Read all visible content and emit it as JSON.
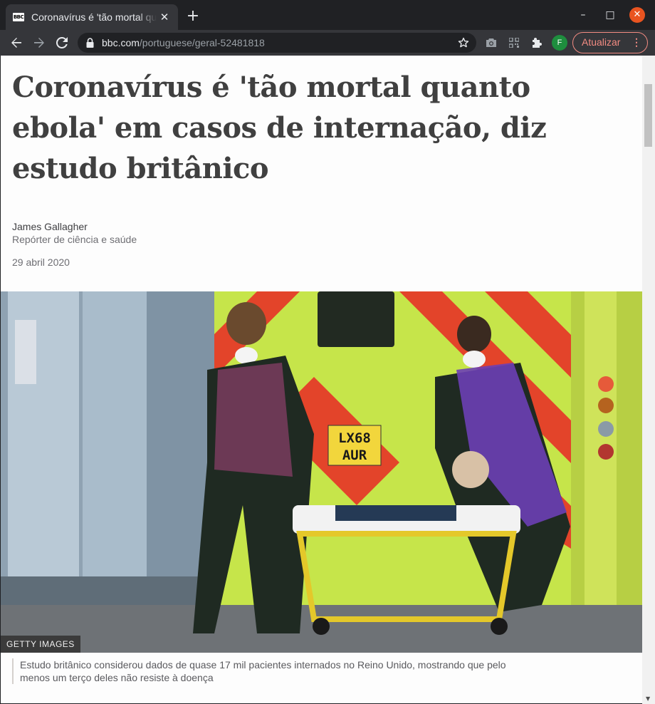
{
  "browser": {
    "tab": {
      "favicon_text": "BBC",
      "title": "Coronavírus é 'tão mortal quanto ebola'",
      "close": "✕"
    },
    "new_tab": "+",
    "window": {
      "minimize": "–",
      "maximize": "□",
      "close": "✕"
    },
    "url": {
      "host": "bbc.com",
      "path": "/portuguese/geral-52481818"
    },
    "profile_initial": "F",
    "update_button": "Atualizar",
    "colors": {
      "update": "#f28b82",
      "profile": "#1e8e3e",
      "close": "#e95420"
    }
  },
  "article": {
    "headline": "Coronavírus é 'tão mortal quanto ebola' em casos de internação, diz estudo britânico",
    "author": "James Gallagher",
    "author_role": "Repórter de ciência e saúde",
    "date": "29 abril 2020",
    "image": {
      "credit": "GETTY IMAGES",
      "plate": [
        "LX68",
        "AUR"
      ],
      "caption": "Estudo britânico considerou dados de quase 17 mil pacientes internados no Reino Unido, mostrando que pelo menos um terço deles não resiste à doença"
    }
  }
}
